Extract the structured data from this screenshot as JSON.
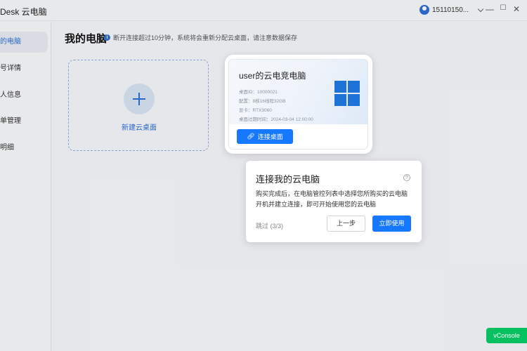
{
  "app": {
    "title": "Desk 云电脑"
  },
  "header": {
    "user_name": "15110150...",
    "minimize": "—",
    "maximize": "☐",
    "close": "✕"
  },
  "sidebar": {
    "items": [
      {
        "label": "的电脑"
      },
      {
        "label": "号详情"
      },
      {
        "label": "人信息"
      },
      {
        "label": "单管理"
      },
      {
        "label": "明细"
      }
    ]
  },
  "main": {
    "title": "我的电脑",
    "notice": "断开连接超过10分钟，系统将会重新分配云桌面，请注意数据保存",
    "new_desktop_label": "新建云桌面"
  },
  "pc_card": {
    "name": "user的云电竞电脑",
    "specs": [
      "桌面ID：10000021",
      "配置：8核16线程32GB",
      "显卡：RTX3060",
      "桌面过期时间：2024-03-04 12:00:00"
    ],
    "connect_label": "连接桌面"
  },
  "guide": {
    "title": "连接我的云电脑",
    "help": "?",
    "description": "购买完成后，在电脑管控列表中选择您所购买的云电脑开机并建立连接，即可开始使用您的云电脑",
    "skip": "跳过 (3/3)",
    "prev_label": "上一步",
    "start_label": "立即使用"
  },
  "vconsole": {
    "label": "vConsole"
  }
}
